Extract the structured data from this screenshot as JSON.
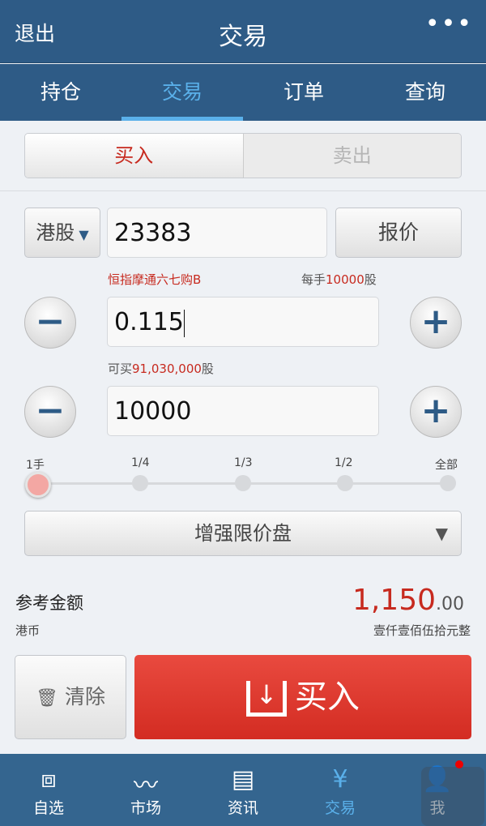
{
  "header": {
    "back": "退出",
    "title": "交易",
    "more_icon": "more-icon"
  },
  "tabs": [
    {
      "label": "持仓"
    },
    {
      "label": "交易",
      "active": true
    },
    {
      "label": "订单"
    },
    {
      "label": "查询"
    }
  ],
  "side_toggle": {
    "buy": "买入",
    "sell": "卖出",
    "selected": "买入"
  },
  "market": {
    "selected": "港股"
  },
  "code": {
    "value": "23383"
  },
  "quote_button": "报价",
  "stock_name": "恒指摩通六七购B",
  "lot": {
    "prefix": "每手",
    "value": "10000",
    "suffix": "股"
  },
  "price": {
    "value": "0.115"
  },
  "buyable": {
    "prefix": "可买",
    "value": "91,030,000",
    "suffix": "股"
  },
  "quantity": {
    "value": "10000"
  },
  "slider": {
    "ticks": [
      "1手",
      "1/4",
      "1/3",
      "1/2",
      "全部"
    ],
    "selected": "1手"
  },
  "order_type": {
    "selected": "增强限价盘"
  },
  "amount": {
    "label": "参考金额",
    "currency": "港币",
    "integer": "1,150",
    "decimal": ".00",
    "words": "壹仟壹佰伍拾元整"
  },
  "clear_button": "清除",
  "buy_button": "买入",
  "bottom_nav": [
    {
      "label": "自选",
      "icon": "watchlist-icon"
    },
    {
      "label": "市场",
      "icon": "market-chart-icon"
    },
    {
      "label": "资讯",
      "icon": "news-icon"
    },
    {
      "label": "交易",
      "icon": "money-bag-icon",
      "active": true
    },
    {
      "label": "我",
      "icon": "user-icon"
    }
  ],
  "colors": {
    "header": "#2e5b86",
    "accent": "#5ab0ea",
    "buy_red": "#e0342a",
    "price_red": "#c72a1f"
  }
}
